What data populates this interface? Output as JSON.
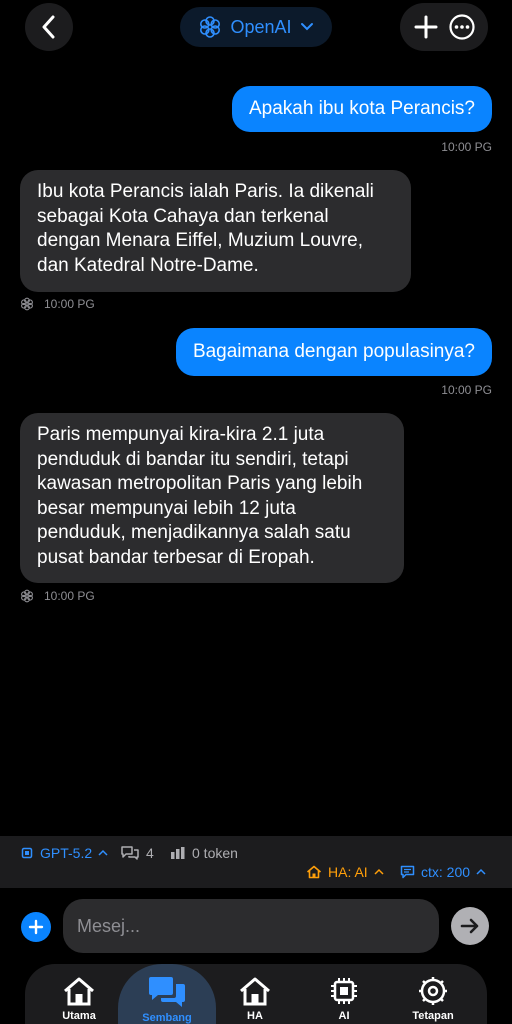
{
  "header": {
    "model_label": "OpenAI"
  },
  "messages": [
    {
      "role": "user",
      "text": "Apakah ibu kota Perancis?",
      "time": "10:00 PG"
    },
    {
      "role": "assistant",
      "lines": [
        "Ibu kota Perancis ialah Paris. Ia dikenali",
        "sebagai Kota Cahaya dan terkenal",
        "dengan Menara Eiffel, Muzium Louvre,",
        "dan Katedral Notre-Dame."
      ],
      "time": "10:00 PG"
    },
    {
      "role": "user",
      "text": "Bagaimana dengan populasinya?",
      "time": "10:00 PG"
    },
    {
      "role": "assistant",
      "lines": [
        "Paris mempunyai kira-kira 2.1 juta",
        "penduduk di bandar itu sendiri, tetapi",
        "kawasan metropolitan Paris yang lebih",
        "besar mempunyai lebih 12 juta",
        "penduduk, menjadikannya salah satu",
        "pusat bandar terbesar di Eropah."
      ],
      "time": "10:00 PG"
    }
  ],
  "status": {
    "model": "GPT-5.2",
    "chats": "4",
    "tokens": "0 token",
    "ha": "HA: AI",
    "ctx": "ctx: 200"
  },
  "composer": {
    "placeholder": "Mesej..."
  },
  "tabs": [
    {
      "label": "Utama",
      "icon": "home-icon"
    },
    {
      "label": "Sembang",
      "icon": "chat-bubbles-icon",
      "active": true
    },
    {
      "label": "HA",
      "icon": "home-icon"
    },
    {
      "label": "AI",
      "icon": "chip-icon"
    },
    {
      "label": "Tetapan",
      "icon": "gear-icon"
    }
  ],
  "colors": {
    "accent": "#0a84ff",
    "bubble_bot": "#2c2c2e",
    "warning": "#ff9f0a"
  }
}
